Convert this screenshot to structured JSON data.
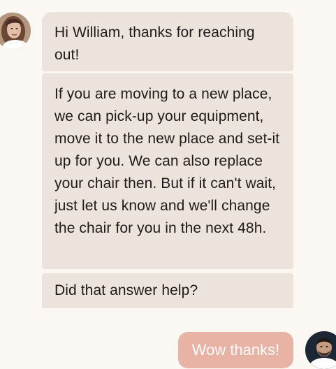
{
  "conversation": {
    "agent": {
      "avatar_icon": "woman-avatar-photo",
      "messages": [
        {
          "text": "Hi William, thanks for reaching out!"
        },
        {
          "text": "If you are moving to a new place, we can pick-up your equipment, move it to the new place and set-it up for you. We can also replace your chair then. But if it can't wait, just let us know and we'll change the chair for you in the next 48h."
        },
        {
          "text": "Did that answer help?"
        }
      ],
      "bubble_color": "#ece4dc"
    },
    "user": {
      "avatar_icon": "man-avatar-photo",
      "messages": [
        {
          "text": "Wow thanks!"
        }
      ],
      "bubble_color": "#e8b2a4"
    }
  }
}
